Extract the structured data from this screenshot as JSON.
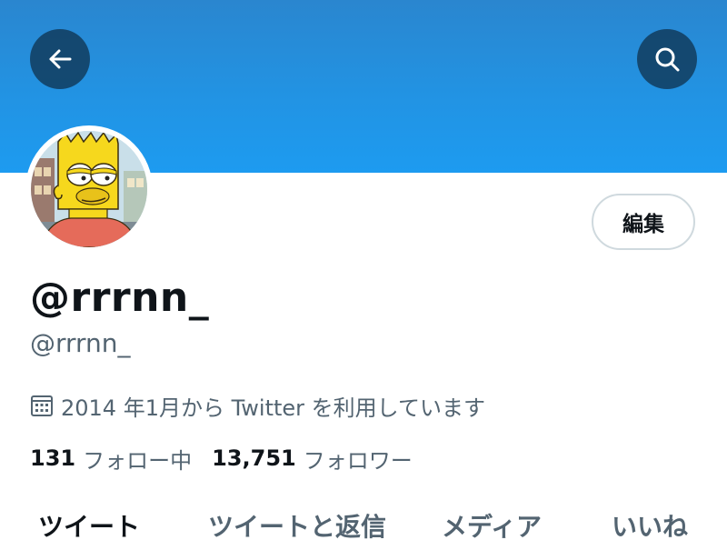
{
  "header": {
    "banner_color": "#1d9bf0",
    "back_icon": "arrow-left-icon",
    "search_icon": "search-icon"
  },
  "profile": {
    "avatar": "bart-simpson-avatar",
    "edit_label": "編集",
    "display_name": "@rrrnn_",
    "handle": "@rrrnn_",
    "join_icon": "calendar-icon",
    "join_text": "2014 年1月から Twitter を利用しています",
    "following_count": "131",
    "following_label": "フォロー中",
    "followers_count": "13,751",
    "followers_label": "フォロワー"
  },
  "tabs": [
    {
      "label": "ツイート",
      "active": true
    },
    {
      "label": "ツイートと返信",
      "active": false
    },
    {
      "label": "メディア",
      "active": false
    },
    {
      "label": "いいね",
      "active": false
    }
  ]
}
